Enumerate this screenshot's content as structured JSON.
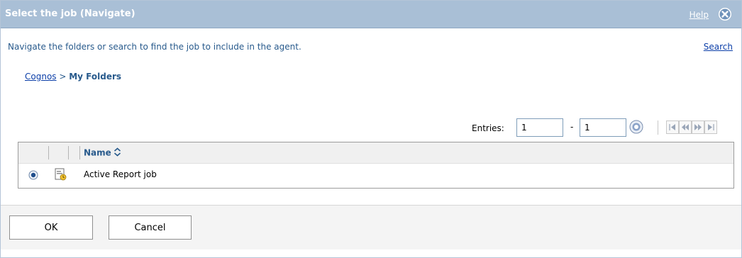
{
  "dialog": {
    "title": "Select the job (Navigate)",
    "help_label": "Help",
    "close_icon": "close-icon",
    "instruction": "Navigate the folders or search to find the job to include in the agent.",
    "search_label": "Search"
  },
  "breadcrumb": {
    "root": "Cognos",
    "separator": " > ",
    "current": "My Folders"
  },
  "pager": {
    "entries_label": "Entries:",
    "from_value": "1",
    "dash": "-",
    "to_value": "1",
    "go_icon": "go-icon",
    "nav_icons": [
      "first-page-icon",
      "previous-page-icon",
      "next-page-icon",
      "last-page-icon"
    ]
  },
  "table": {
    "columns": [
      "",
      "",
      "Name"
    ],
    "sort_icon": "sort-icon",
    "rows": [
      {
        "selected": true,
        "icon": "job-icon",
        "name": "Active Report job"
      }
    ]
  },
  "footer": {
    "ok_label": "OK",
    "cancel_label": "Cancel"
  },
  "colors": {
    "title_bar": "#a9bfd6",
    "link": "#0b3ea8",
    "text_blue": "#285a8c"
  }
}
